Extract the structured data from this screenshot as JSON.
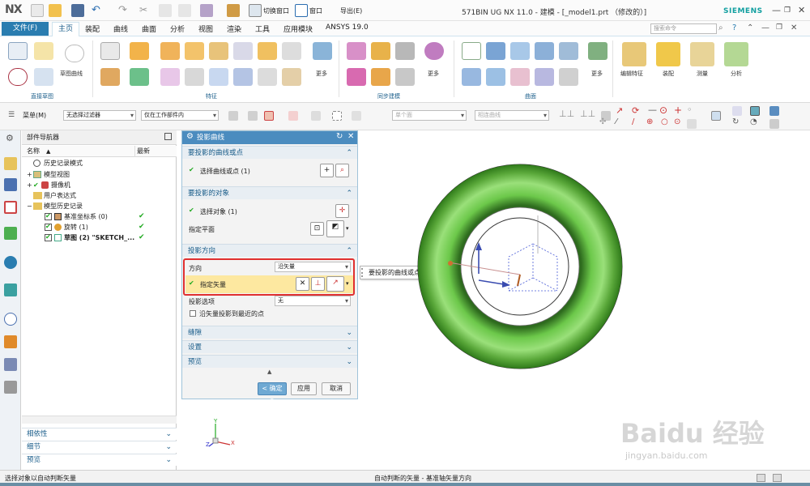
{
  "app": {
    "logo": "NX",
    "title": "571BIN UG NX 11.0 - 建模 - [_model1.prt （修改的）]",
    "brand": "SIEMENS",
    "switch_window": "切换窗口",
    "window_menu": "窗口",
    "export_menu": "导出(E)",
    "command_search_placeholder": "搜索命令",
    "accent_color": "#2a7db0"
  },
  "tabs": [
    {
      "label": "文件(F)"
    },
    {
      "label": "主页"
    },
    {
      "label": "装配"
    },
    {
      "label": "曲线"
    },
    {
      "label": "曲面"
    },
    {
      "label": "分析"
    },
    {
      "label": "视图"
    },
    {
      "label": "渲染"
    },
    {
      "label": "工具"
    },
    {
      "label": "应用模块"
    },
    {
      "label": "ANSYS 19.0"
    }
  ],
  "ribbon": {
    "groups": [
      "直接草图",
      "特征",
      "同步建模",
      "曲面"
    ],
    "labels": {
      "sketch_curve": "草图曲线",
      "more1": "更多",
      "more2": "更多",
      "more3": "更多",
      "edit_feature": "编辑特征",
      "assembly": "装配",
      "measure": "测量",
      "analysis": "分析"
    }
  },
  "toolbar": {
    "menu": "菜单(M)",
    "filter": "无选择过滤器",
    "scope": "仅在工作部件内",
    "face": "单个面",
    "curve": "相连曲线"
  },
  "navigator": {
    "title": "部件导航器",
    "col_name": "名称",
    "col_latest": "最新",
    "items": [
      {
        "label": "历史记录模式",
        "check": ""
      },
      {
        "label": "模型视图",
        "check": ""
      },
      {
        "label": "摄像机",
        "check": ""
      },
      {
        "label": "用户表达式",
        "check": ""
      },
      {
        "label": "模型历史记录",
        "check": ""
      },
      {
        "label": "基准坐标系 (0)",
        "check": "✔"
      },
      {
        "label": "旋转 (1)",
        "check": "✔"
      },
      {
        "label": "草图 (2) \"SKETCH_...",
        "check": "✔"
      }
    ],
    "sections": [
      "相依性",
      "细节",
      "预览"
    ]
  },
  "dialog": {
    "title": "投影曲线",
    "sec_curves": "要投影的曲线或点",
    "select_curves": "选择曲线或点 (1)",
    "sec_object": "要投影的对象",
    "select_object": "选择对象 (1)",
    "specify_plane": "指定平面",
    "sec_direction": "投影方向",
    "direction_label": "方向",
    "direction_value": "沿矢量",
    "specify_vector": "指定矢量",
    "proj_option_label": "投影选项",
    "proj_option_value": "无",
    "nearest_point": "沿矢量投影到最近的点",
    "sec_associativity": "缝隙",
    "sec_settings": "设置",
    "sec_preview": "预览",
    "ok": "< 确定 >",
    "apply": "应用",
    "cancel": "取消"
  },
  "tooltip": "要投影的曲线或点",
  "status": {
    "left": "选择对象以自动判断矢量",
    "center": "自动判断的矢量 - 基准轴矢量方向"
  },
  "watermark": {
    "logo": "Baidu 经验",
    "url": "jingyan.baidu.com"
  },
  "triad": {
    "x": "X",
    "y": "Y",
    "z": "Z"
  }
}
